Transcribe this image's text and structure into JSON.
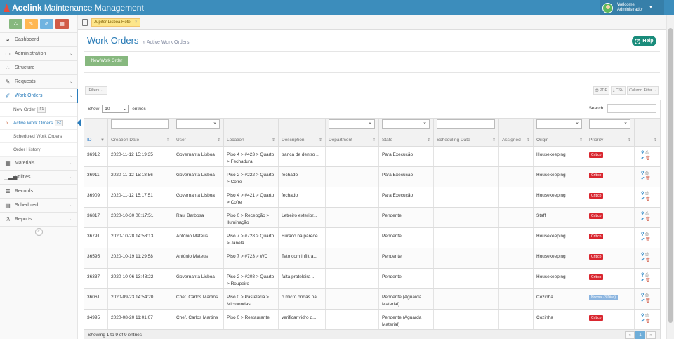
{
  "app": {
    "brand_bold": "Acelink",
    "brand_rest": "Maintenance Management",
    "welcome_line1": "Welcome,",
    "welcome_line2": "Administrador",
    "colors": {
      "topbar": "#3c8dbc",
      "link": "#2679b5",
      "critical": "#d9262f",
      "normal": "#8bb5e0"
    }
  },
  "quick_buttons": [
    {
      "icon": "sitemap-icon",
      "glyph": "⛬",
      "color": "#87b87f"
    },
    {
      "icon": "wrench-check-icon",
      "glyph": "✎",
      "color": "#ffb752"
    },
    {
      "icon": "wrench-icon",
      "glyph": "✐",
      "color": "#6fb3e0"
    },
    {
      "icon": "calendar-icon",
      "glyph": "▦",
      "color": "#d15b47"
    }
  ],
  "sidebar": {
    "items": [
      {
        "label": "Dashboard",
        "icon": "tachometer-icon",
        "glyph": "◕",
        "chevron": false
      },
      {
        "label": "Administration",
        "icon": "desktop-icon",
        "glyph": "▭",
        "chevron": true
      },
      {
        "label": "Structure",
        "icon": "sitemap-icon",
        "glyph": "⛬",
        "chevron": false
      },
      {
        "label": "Requests",
        "icon": "edit-icon",
        "glyph": "✎",
        "chevron": true
      },
      {
        "label": "Work Orders",
        "icon": "wrench-icon",
        "glyph": "✐",
        "chevron": true,
        "active": true
      }
    ],
    "subitems": [
      {
        "label": "New Order",
        "kbd": "F1"
      },
      {
        "label": "Active Work Orders",
        "kbd": "F2",
        "active": true
      },
      {
        "label": "Scheduled Work Orders",
        "kbd": ""
      },
      {
        "label": "Order History",
        "kbd": ""
      }
    ],
    "items_after": [
      {
        "label": "Materials",
        "icon": "th-icon",
        "glyph": "▦",
        "chevron": true
      },
      {
        "label": "Utilities",
        "icon": "bar-chart-icon",
        "glyph": "▁▃▅",
        "chevron": true
      },
      {
        "label": "Records",
        "icon": "list-icon",
        "glyph": "☰",
        "chevron": false
      },
      {
        "label": "Scheduled",
        "icon": "calendar-icon",
        "glyph": "▤",
        "chevron": true
      },
      {
        "label": "Reports",
        "icon": "flask-icon",
        "glyph": "⚗",
        "chevron": true
      }
    ]
  },
  "tab": {
    "label": "Jupiter Lisboa Hotel",
    "close": "×"
  },
  "page": {
    "title": "Work Orders",
    "subtitle": "» Active Work Orders",
    "help_label": "Help",
    "new_button": "New Work Order",
    "filters_label": "Filters ⌄",
    "export_pdf": "⎙ PDF",
    "export_csv": "⤓ CSV",
    "column_filter": "Column Filter ⌄"
  },
  "table": {
    "show_label": "Show",
    "entries_value": "10",
    "entries_label": "entries",
    "search_label": "Search:",
    "columns": [
      "ID",
      "Creation Date",
      "User",
      "Location",
      "Description",
      "Department",
      "State",
      "Scheduling Date",
      "Assigned",
      "Origin",
      "Priority",
      ""
    ],
    "rows": [
      {
        "id": "36912",
        "date": "2020-11-12 15:19:35",
        "user": "Governanta Lisboa",
        "location": "Piso 4 > #423 > Quarto > Fechadura",
        "description": "tranca de dentro ...",
        "department": "",
        "state": "Para Execução",
        "scheduling": "",
        "assigned": "",
        "origin": "Housekeeping",
        "priority": "Crítico",
        "priority_color": "#d9262f"
      },
      {
        "id": "36911",
        "date": "2020-11-12 15:18:56",
        "user": "Governanta Lisboa",
        "location": "Piso 2 > #222 > Quarto > Cofre",
        "description": "fechado",
        "department": "",
        "state": "Para Execução",
        "scheduling": "",
        "assigned": "",
        "origin": "Housekeeping",
        "priority": "Crítico",
        "priority_color": "#d9262f"
      },
      {
        "id": "36909",
        "date": "2020-11-12 15:17:51",
        "user": "Governanta Lisboa",
        "location": "Piso 4 > #421 > Quarto > Cofre",
        "description": "fechado",
        "department": "",
        "state": "Para Execução",
        "scheduling": "",
        "assigned": "",
        "origin": "Housekeeping",
        "priority": "Crítico",
        "priority_color": "#d9262f"
      },
      {
        "id": "36817",
        "date": "2020-10-30 00:17:51",
        "user": "Raul Barbosa",
        "location": "Piso 0 > Recepção > Iluminação",
        "description": "Letreiro exterior...",
        "department": "",
        "state": "Pendente",
        "scheduling": "",
        "assigned": "",
        "origin": "Staff",
        "priority": "Crítico",
        "priority_color": "#d9262f"
      },
      {
        "id": "36791",
        "date": "2020-10-28 14:53:13",
        "user": "António Mateus",
        "location": "Piso 7 > #728 > Quarto > Janela",
        "description": "Buraco na parede ...",
        "department": "",
        "state": "Pendente",
        "scheduling": "",
        "assigned": "",
        "origin": "Housekeeping",
        "priority": "Crítico",
        "priority_color": "#d9262f"
      },
      {
        "id": "36595",
        "date": "2020-10-19 11:29:58",
        "user": "António Mateus",
        "location": "Piso 7 > #723 > WC",
        "description": "Teto com infiltra...",
        "department": "",
        "state": "Pendente",
        "scheduling": "",
        "assigned": "",
        "origin": "Housekeeping",
        "priority": "Crítico",
        "priority_color": "#d9262f"
      },
      {
        "id": "36337",
        "date": "2020-10-06 13:48:22",
        "user": "Governanta Lisboa",
        "location": "Piso 2 > #208 > Quarto > Roupeiro",
        "description": "falta prateleira ...",
        "department": "",
        "state": "Pendente",
        "scheduling": "",
        "assigned": "",
        "origin": "Housekeeping",
        "priority": "Crítico",
        "priority_color": "#d9262f"
      },
      {
        "id": "36061",
        "date": "2020-09-23 14:54:20",
        "user": "Chef. Carlos Martins",
        "location": "Piso 0 > Pastelaria > Microondas",
        "description": "o micro ondas nã...",
        "department": "",
        "state": "Pendente (Aguarda Material)",
        "scheduling": "",
        "assigned": "",
        "origin": "Cozinha",
        "priority": "Normal (3 Dias)",
        "priority_color": "#8bb5e0"
      },
      {
        "id": "34995",
        "date": "2020-08-20 11:01:07",
        "user": "Chef. Carlos Martins",
        "location": "Piso 0 > Restaurante",
        "description": "verificar vidro d...",
        "department": "",
        "state": "Pendente (Aguarda Material)",
        "scheduling": "",
        "assigned": "",
        "origin": "Cozinha",
        "priority": "Crítico",
        "priority_color": "#d9262f"
      }
    ],
    "info": "Showing 1 to 9 of 9 entries",
    "pager": [
      "«",
      "1",
      "»"
    ]
  }
}
